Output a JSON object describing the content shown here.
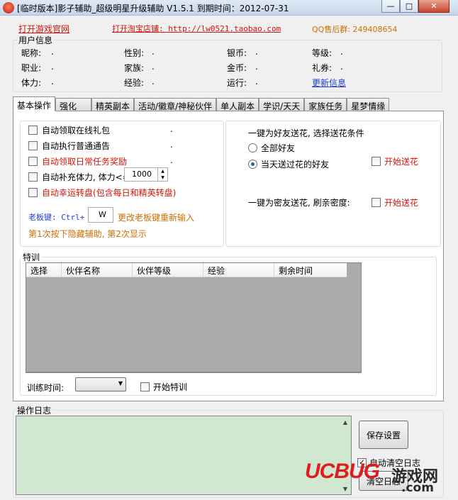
{
  "window": {
    "title": "[临时版本]影子辅助_超级明星升级辅助 V1.5.1   到期时间：2012-07-31",
    "min": "—",
    "max": "□",
    "close": "✕"
  },
  "toplinks": {
    "site": "打开游戏官网",
    "shop": "打开淘宝店铺: http://lw0521.taobao.com",
    "qq": "QQ售后群: 249408654"
  },
  "userinfo": {
    "group_label": "用户信息",
    "fields": [
      {
        "label": "昵称:",
        "value": "."
      },
      {
        "label": "性别:",
        "value": "."
      },
      {
        "label": "银币:",
        "value": "."
      },
      {
        "label": "等级:",
        "value": "."
      },
      {
        "label": "职业:",
        "value": "."
      },
      {
        "label": "家族:",
        "value": "."
      },
      {
        "label": "金币:",
        "value": "."
      },
      {
        "label": "礼券:",
        "value": "."
      },
      {
        "label": "体力:",
        "value": "."
      },
      {
        "label": "经验:",
        "value": "."
      },
      {
        "label": "运行:",
        "value": "."
      }
    ],
    "update_link": "更新信息"
  },
  "tabs": [
    "基本操作",
    "强化",
    "精英副本",
    "活动/徽章/神秘伙伴",
    "单人副本",
    "学识/天天",
    "家族任务",
    "星梦情缘"
  ],
  "basic": {
    "options": [
      {
        "label": "自动领取在线礼包",
        "dot": "."
      },
      {
        "label": "自动执行普通通告",
        "dot": "."
      },
      {
        "label": "自动领取日常任务奖励",
        "dot": "."
      },
      {
        "label": "自动补充体力, 体力<=",
        "dot": ""
      },
      {
        "label": "自动幸运转盘(包含每日和精英转盘)",
        "dot": ""
      }
    ],
    "stamina_value": "1000",
    "hotkey_label": "老板键: Ctrl+",
    "hotkey_value": "W",
    "hotkey_hint": "更改老板键重新输入",
    "hide_hint": "第1次按下隐藏辅助, 第2次显示"
  },
  "flowers": {
    "friend_title": "一键为好友送花, 选择送花条件",
    "radio_all": "全部好友",
    "radio_today": "当天送过花的好友",
    "start1": "开始送花",
    "close_title": "一键为密友送花, 刷亲密度:",
    "start2": "开始送花"
  },
  "training": {
    "group_label": "特训",
    "columns": [
      "选择",
      "伙伴名称",
      "伙伴等级",
      "经验",
      "剩余时间"
    ],
    "time_label": "训练时间:",
    "start_label": "开始特训"
  },
  "log": {
    "group_label": "操作日志",
    "save_button": "保存设置",
    "auto_clear": "自动清空日志",
    "clear_button": "清空日志"
  },
  "watermark": {
    "text1": "UCBUG",
    "text2": "游戏网",
    "text3": ".com"
  },
  "colors": {
    "red": "#d4140b",
    "orange": "#cc6f00",
    "blue": "#1f3bd7",
    "log_bg": "#cfe8cf"
  }
}
